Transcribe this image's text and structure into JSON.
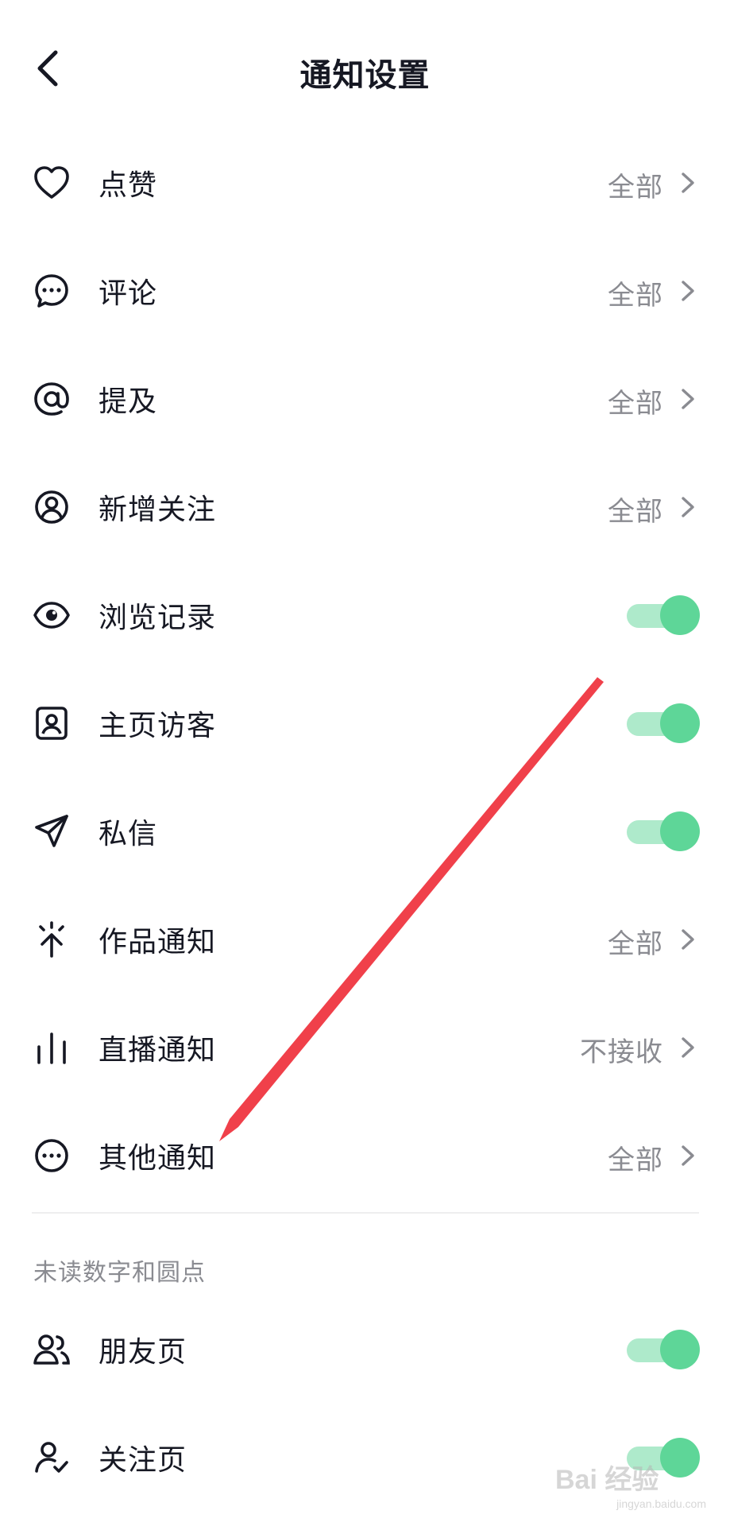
{
  "header": {
    "title": "通知设置"
  },
  "rows": [
    {
      "id": "likes",
      "icon": "heart-icon",
      "label": "点赞",
      "value": "全部",
      "type": "link"
    },
    {
      "id": "comments",
      "icon": "comment-bubble-icon",
      "label": "评论",
      "value": "全部",
      "type": "link"
    },
    {
      "id": "mentions",
      "icon": "at-sign-icon",
      "label": "提及",
      "value": "全部",
      "type": "link"
    },
    {
      "id": "new-follows",
      "icon": "user-circle-icon",
      "label": "新增关注",
      "value": "全部",
      "type": "link"
    },
    {
      "id": "browse-history",
      "icon": "eye-icon",
      "label": "浏览记录",
      "on": true,
      "type": "toggle"
    },
    {
      "id": "profile-visitors",
      "icon": "profile-card-icon",
      "label": "主页访客",
      "on": true,
      "type": "toggle"
    },
    {
      "id": "direct-messages",
      "icon": "paper-plane-icon",
      "label": "私信",
      "on": true,
      "type": "toggle"
    },
    {
      "id": "works",
      "icon": "sparkle-arrow-icon",
      "label": "作品通知",
      "value": "全部",
      "type": "link"
    },
    {
      "id": "live",
      "icon": "bar-chart-icon",
      "label": "直播通知",
      "value": "不接收",
      "type": "link"
    },
    {
      "id": "other",
      "icon": "more-circle-icon",
      "label": "其他通知",
      "value": "全部",
      "type": "link"
    }
  ],
  "section": {
    "label": "未读数字和圆点"
  },
  "rows2": [
    {
      "id": "friends-page",
      "icon": "users-icon",
      "label": "朋友页",
      "on": true,
      "type": "toggle"
    },
    {
      "id": "following-page",
      "icon": "user-check-icon",
      "label": "关注页",
      "on": true,
      "type": "toggle"
    }
  ],
  "colors": {
    "toggle_on": "#5ed698",
    "annotation_arrow": "#f0404a",
    "text": "#161823",
    "muted": "#8a8b91"
  },
  "watermark": {
    "text": "Bai 经验",
    "sub": "jingyan.baidu.com"
  }
}
